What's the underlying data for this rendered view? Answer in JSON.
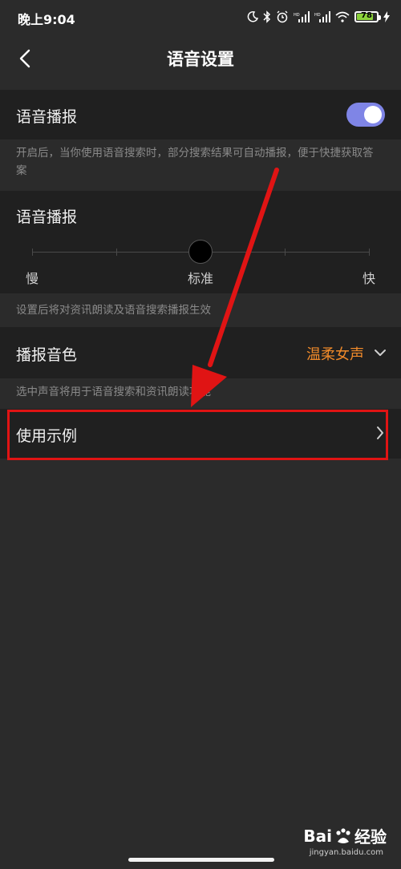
{
  "status_bar": {
    "time": "晚上9:04",
    "battery": "78"
  },
  "nav": {
    "title": "语音设置"
  },
  "voice_broadcast": {
    "label": "语音播报",
    "enabled": true,
    "description": "开启后，当你使用语音搜索时，部分搜索结果可自动播报，便于快捷获取答案"
  },
  "speed": {
    "label": "语音播报",
    "slow_label": "慢",
    "standard_label": "标准",
    "fast_label": "快",
    "value": "标准",
    "description": "设置后将对资讯朗读及语音搜索播报生效"
  },
  "voice_tone": {
    "label": "播报音色",
    "value": "温柔女声",
    "description": "选中声音将用于语音搜索和资讯朗读功能"
  },
  "example": {
    "label": "使用示例"
  },
  "watermark": {
    "brand_left": "Bai",
    "brand_right": "经验",
    "url": "jingyan.baidu.com"
  },
  "colors": {
    "accent_toggle": "#7f85e6",
    "accent_value": "#f08a2a",
    "highlight_red": "#e01414"
  }
}
